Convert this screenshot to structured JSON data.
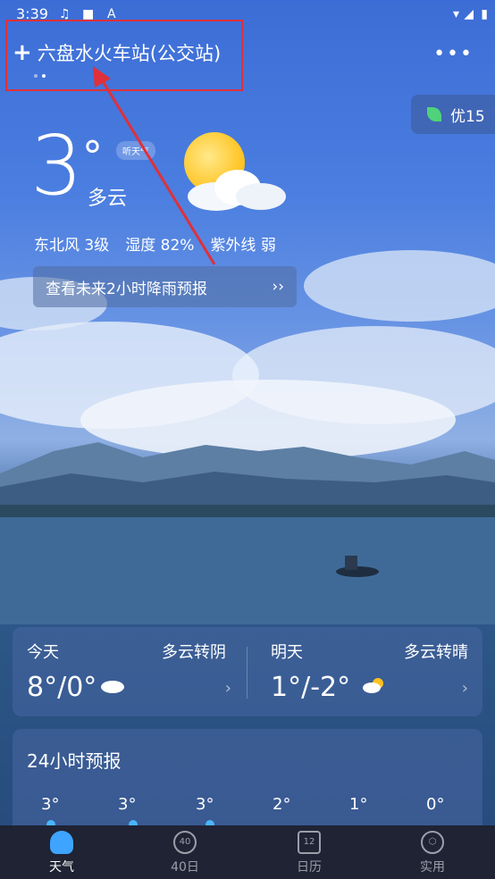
{
  "status": {
    "time": "3:39"
  },
  "header": {
    "city": "六盘水火车站(公交站)",
    "plus_icon": "plus-icon",
    "more_icon": "more-dots-icon"
  },
  "aqi": {
    "label": "优15",
    "color": "#4fd27b"
  },
  "current": {
    "temp": "3",
    "degree": "°",
    "condition": "多云",
    "listen_label": "听天气",
    "wind": "东北风 3级",
    "humidity": "湿度 82%",
    "uv": "紫外线 弱"
  },
  "rain_forecast": {
    "label": "查看未来2小时降雨预报",
    "chevron": "››"
  },
  "daily": {
    "today": {
      "label": "今天",
      "condition": "多云转阴",
      "temp": "8°/0°"
    },
    "tomorrow": {
      "label": "明天",
      "condition": "多云转晴",
      "temp": "1°/-2°"
    }
  },
  "forecast24": {
    "title": "24小时预报",
    "hours": [
      "3°",
      "3°",
      "3°",
      "2°",
      "1°",
      "0°"
    ]
  },
  "tabs": [
    {
      "label": "天气",
      "icon": "cloud-icon",
      "active": true
    },
    {
      "label": "40日",
      "icon": "forty-day-icon",
      "active": false
    },
    {
      "label": "日历",
      "icon": "calendar-icon",
      "active": false
    },
    {
      "label": "实用",
      "icon": "tools-icon",
      "active": false
    }
  ]
}
